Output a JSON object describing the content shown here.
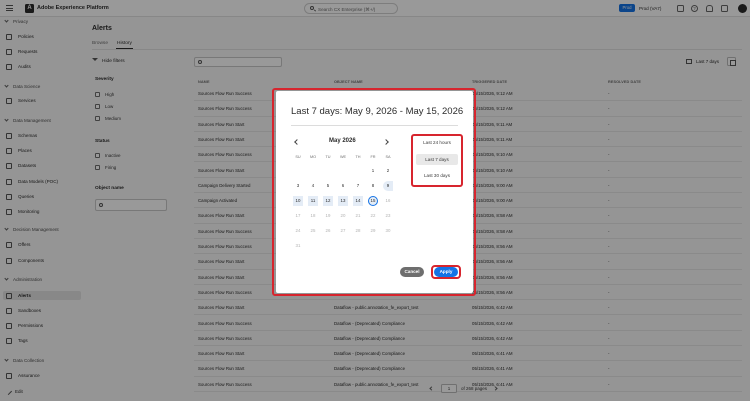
{
  "app": {
    "logo_glyph": "A",
    "title": "Adobe Experience Platform"
  },
  "header": {
    "search_placeholder": "Search CX Enterprise (⌘+/)",
    "sandbox_badge": "Prod",
    "sandbox_name": "Prod (VA7)",
    "help_glyph": "?"
  },
  "sidebar": {
    "sections": [
      {
        "label": "Privacy",
        "items": [
          "Policies",
          "Requests",
          "Audits"
        ]
      },
      {
        "label": "Data Science",
        "items": [
          "Services"
        ]
      },
      {
        "label": "Data Management",
        "items": [
          "Schemas",
          "Places",
          "Datasets",
          "Data Models (POC)",
          "Queries",
          "Monitoring"
        ]
      },
      {
        "label": "Decision Management",
        "items": [
          "Offers",
          "Components"
        ]
      },
      {
        "label": "Administration",
        "items": [
          "Alerts",
          "Sandboxes",
          "Permissions",
          "Tags"
        ]
      },
      {
        "label": "Data Collection",
        "items": [
          "Assurance"
        ]
      }
    ],
    "edit_label": "Edit"
  },
  "page": {
    "title": "Alerts",
    "tabs": [
      "Browse",
      "History"
    ],
    "hide_filters": "Hide filters",
    "range_label": "Last 7 days"
  },
  "filters": {
    "severity_title": "Severity",
    "severity": [
      "High",
      "Low",
      "Medium"
    ],
    "status_title": "Status",
    "status": [
      "Inactive",
      "Firing"
    ],
    "object_title": "Object name"
  },
  "table": {
    "headers": [
      "NAME",
      "OBJECT NAME",
      "TRIGGERED DATE",
      "RESOLVED DATE"
    ],
    "rows": [
      [
        "Sources Flow Run Success",
        "",
        "05/15/2026, 9:12 AM",
        "-"
      ],
      [
        "Sources Flow Run Success",
        "",
        "05/15/2026, 9:12 AM",
        "-"
      ],
      [
        "Sources Flow Run Start",
        "",
        "05/15/2026, 9:11 AM",
        "-"
      ],
      [
        "Sources Flow Run Start",
        "",
        "05/15/2026, 9:11 AM",
        "-"
      ],
      [
        "Sources Flow Run Success",
        "",
        "05/15/2026, 9:10 AM",
        "-"
      ],
      [
        "Sources Flow Run Start",
        "",
        "05/15/2026, 9:10 AM",
        "-"
      ],
      [
        "Campaign Delivery Started",
        "",
        "05/15/2026, 9:00 AM",
        "-"
      ],
      [
        "Campaign Activated",
        "",
        "05/15/2026, 9:00 AM",
        "-"
      ],
      [
        "Sources Flow Run Start",
        "",
        "05/15/2026, 8:58 AM",
        "-"
      ],
      [
        "Sources Flow Run Success",
        "",
        "05/15/2026, 8:58 AM",
        "-"
      ],
      [
        "Sources Flow Run Success",
        "",
        "05/15/2026, 8:56 AM",
        "-"
      ],
      [
        "Sources Flow Run Start",
        "",
        "05/15/2026, 8:56 AM",
        "-"
      ],
      [
        "Sources Flow Run Start",
        "",
        "05/15/2026, 8:56 AM",
        "-"
      ],
      [
        "Sources Flow Run Success",
        "",
        "05/15/2026, 8:56 AM",
        "-"
      ],
      [
        "Sources Flow Run Start",
        "Dataflow - public.annotation_fe_export_test",
        "05/15/2026, 6:42 AM",
        "-"
      ],
      [
        "Sources Flow Run Success",
        "Dataflow - (Deprecated) Compliance",
        "05/15/2026, 6:42 AM",
        "-"
      ],
      [
        "Sources Flow Run Success",
        "Dataflow - (Deprecated) Compliance",
        "05/15/2026, 6:42 AM",
        "-"
      ],
      [
        "Sources Flow Run Start",
        "Dataflow - (Deprecated) Compliance",
        "05/15/2026, 6:41 AM",
        "-"
      ],
      [
        "Sources Flow Run Start",
        "Dataflow - (Deprecated) Compliance",
        "05/15/2026, 6:41 AM",
        "-"
      ],
      [
        "Sources Flow Run Success",
        "Dataflow - public.annotation_fe_export_test",
        "05/15/2026, 6:41 AM",
        "-"
      ]
    ]
  },
  "pager": {
    "page": "1",
    "of_pages": "of 268 pages"
  },
  "modal": {
    "title": "Last 7 days: May 9, 2026 - May 15, 2026",
    "month": "May 2026",
    "weekdays": [
      "SU",
      "MO",
      "TU",
      "WE",
      "TH",
      "FR",
      "SA"
    ],
    "range_options": [
      "Last 24 hours",
      "Last 7 days",
      "Last 30 days"
    ],
    "selected_option": "Last 7 days",
    "cancel": "Cancel",
    "apply": "Apply"
  },
  "colors": {
    "accent": "#1473e6",
    "highlight": "#d7252e"
  }
}
